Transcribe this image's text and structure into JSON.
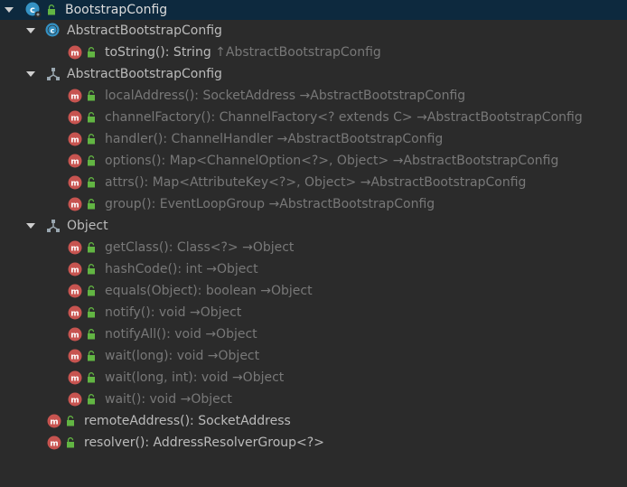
{
  "root": {
    "label": "BootstrapConfig",
    "icon": "class-icon"
  },
  "groups": [
    {
      "title": "AbstractBootstrapConfig",
      "icon": "class-icon",
      "members": [
        {
          "label": "toString(): String",
          "origin": "↑AbstractBootstrapConfig"
        }
      ]
    },
    {
      "title": "AbstractBootstrapConfig",
      "icon": "inherited-group-icon",
      "members": [
        {
          "label": "localAddress(): SocketAddress",
          "origin": "→AbstractBootstrapConfig"
        },
        {
          "label": "channelFactory(): ChannelFactory<? extends C>",
          "origin": "→AbstractBootstrapConfig"
        },
        {
          "label": "handler(): ChannelHandler",
          "origin": "→AbstractBootstrapConfig"
        },
        {
          "label": "options(): Map<ChannelOption<?>, Object>",
          "origin": "→AbstractBootstrapConfig"
        },
        {
          "label": "attrs(): Map<AttributeKey<?>, Object>",
          "origin": "→AbstractBootstrapConfig"
        },
        {
          "label": "group(): EventLoopGroup",
          "origin": "→AbstractBootstrapConfig"
        }
      ]
    },
    {
      "title": "Object",
      "icon": "inherited-group-icon",
      "members": [
        {
          "label": "getClass(): Class<?>",
          "origin": "→Object"
        },
        {
          "label": "hashCode(): int",
          "origin": "→Object"
        },
        {
          "label": "equals(Object): boolean",
          "origin": "→Object"
        },
        {
          "label": "notify(): void",
          "origin": "→Object"
        },
        {
          "label": "notifyAll(): void",
          "origin": "→Object"
        },
        {
          "label": "wait(long): void",
          "origin": "→Object"
        },
        {
          "label": "wait(long, int): void",
          "origin": "→Object"
        },
        {
          "label": "wait(): void",
          "origin": "→Object"
        }
      ]
    }
  ],
  "own_members": [
    {
      "label": "remoteAddress(): SocketAddress"
    },
    {
      "label": "resolver(): AddressResolverGroup<?>"
    }
  ],
  "colors": {
    "background": "#2b2b2b",
    "selected_row": "#0d293e",
    "text": "#bbbbbb",
    "inherited_text": "#787878",
    "method_badge": "#c75450",
    "lock": "#62b543",
    "class_badge": "#3592c4"
  }
}
